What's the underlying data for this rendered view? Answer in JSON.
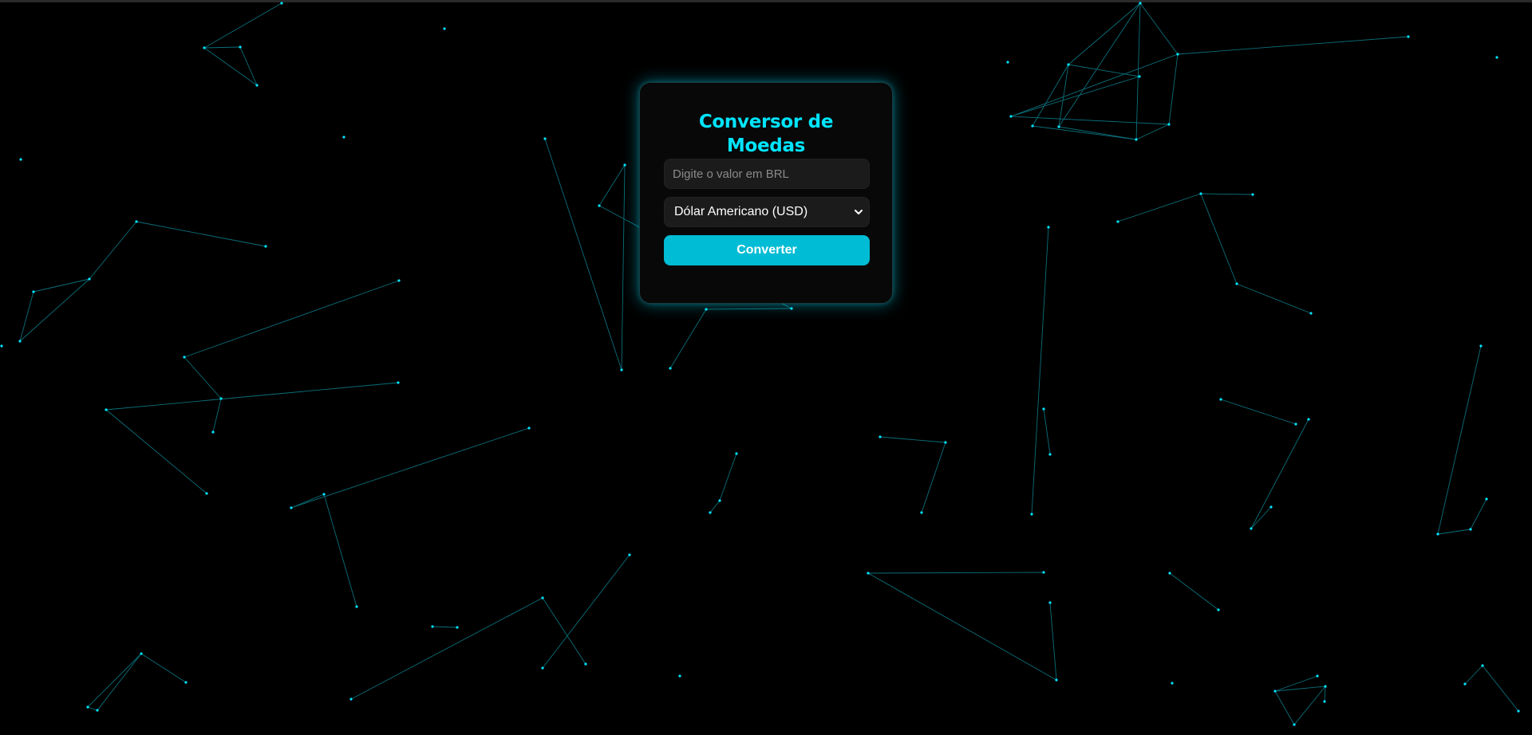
{
  "app": {
    "title": "Conversor de Moedas"
  },
  "form": {
    "amount_value": "",
    "amount_placeholder": "Digite o valor em BRL",
    "currency_selected": "Dólar Americano (USD)",
    "convert_label": "Converter"
  },
  "icons": {
    "select_chevron": "chevron-down-icon"
  },
  "colors": {
    "background": "#000000",
    "accent": "#00e5ff",
    "button": "#00bcd4",
    "particle": "#00e5ff",
    "link_line": "#0a6f7a"
  }
}
